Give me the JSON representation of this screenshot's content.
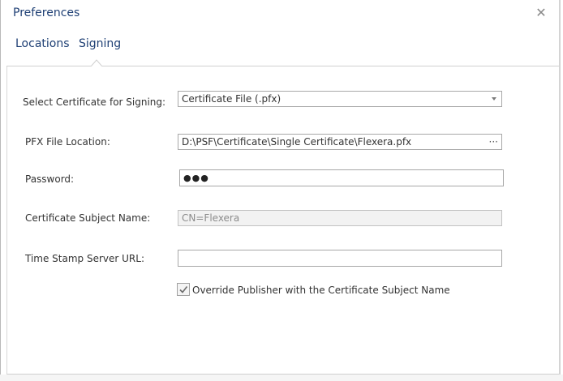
{
  "window": {
    "title": "Preferences"
  },
  "tabs": [
    {
      "label": "Locations",
      "selected": false
    },
    {
      "label": "Signing",
      "selected": true
    }
  ],
  "signing": {
    "certificate_label": "Select Certificate for Signing:",
    "certificate_value": "Certificate File (.pfx)",
    "pfx_label": "PFX File Location:",
    "pfx_value": "D:\\PSF\\Certificate\\Single Certificate\\Flexera.pfx",
    "browse_label": "···",
    "password_label": "Password:",
    "password_masked": "●●●",
    "subject_label": "Certificate Subject Name:",
    "subject_value": "CN=Flexera",
    "timestamp_label": "Time Stamp Server URL:",
    "timestamp_value": "",
    "override_label": "Override Publisher with the Certificate Subject Name",
    "override_checked": true
  },
  "colors": {
    "accent": "#1e3f74",
    "border": "#a8a8a8",
    "disabled_bg": "#f2f2f2"
  }
}
